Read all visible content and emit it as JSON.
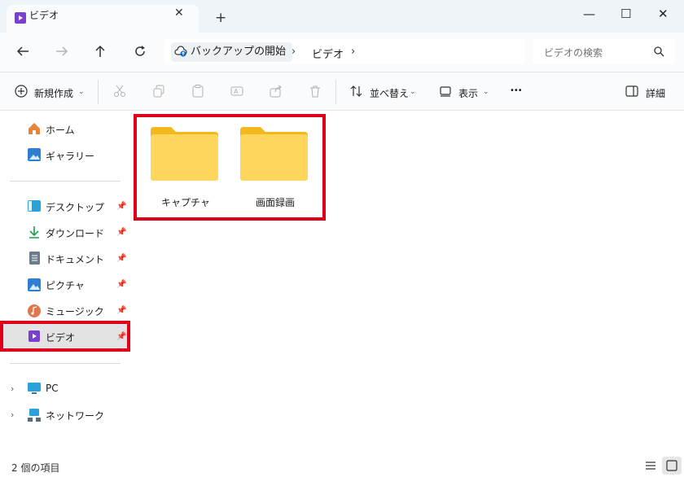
{
  "window": {
    "tab_title": "ビデオ",
    "close_tab_glyph": "✕",
    "new_tab_glyph": "+"
  },
  "window_controls": {
    "minimize_glyph": "—",
    "maximize_glyph": "☐",
    "close_glyph": "✕"
  },
  "address": {
    "segments": [
      "バックアップの開始",
      "ビデオ"
    ],
    "separator": "›"
  },
  "search": {
    "placeholder": "ビデオの検索"
  },
  "toolbar": {
    "new_label": "新規作成",
    "sort_label": "並べ替え",
    "view_label": "表示",
    "more_glyph": "•••",
    "details_label": "詳細"
  },
  "sidebar": {
    "items": [
      {
        "label": "ホーム",
        "icon": "home-icon"
      },
      {
        "label": "ギャラリー",
        "icon": "gallery-icon"
      },
      {
        "label": "デスクトップ",
        "icon": "desktop-icon",
        "pinned": true
      },
      {
        "label": "ダウンロード",
        "icon": "download-icon",
        "pinned": true
      },
      {
        "label": "ドキュメント",
        "icon": "document-icon",
        "pinned": true
      },
      {
        "label": "ピクチャ",
        "icon": "picture-icon",
        "pinned": true
      },
      {
        "label": "ミュージック",
        "icon": "music-icon",
        "pinned": true
      },
      {
        "label": "ビデオ",
        "icon": "video-icon",
        "pinned": true,
        "selected": true
      },
      {
        "label": "PC",
        "icon": "pc-icon"
      },
      {
        "label": "ネットワーク",
        "icon": "network-icon"
      }
    ]
  },
  "folders": [
    {
      "name": "キャプチャ"
    },
    {
      "name": "画面録画"
    }
  ],
  "status": {
    "text": "2 個の項目"
  },
  "colors": {
    "highlight": "#e1001a",
    "folder": "#ffd65c",
    "accent": "#0067c0",
    "video_purple": "#7a3fd0"
  }
}
